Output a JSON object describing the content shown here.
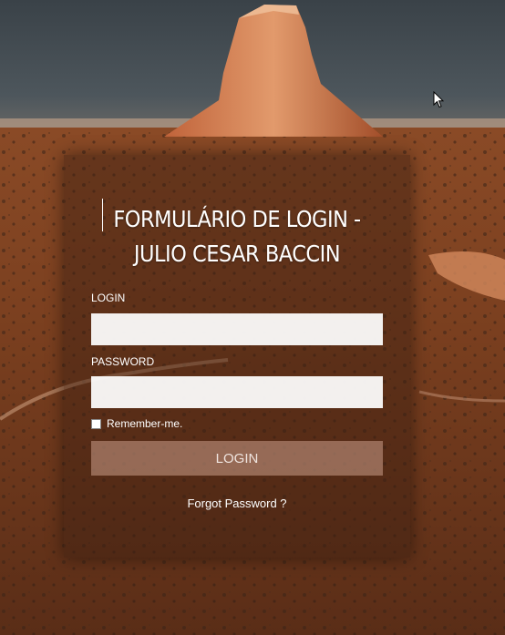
{
  "form": {
    "title_line1": "FORMULÁRIO DE LOGIN -",
    "title_line2": "JULIO CESAR BACCIN",
    "login_label": "LOGIN",
    "login_value": "",
    "password_label": "PASSWORD",
    "password_value": "",
    "remember_label": "Remember-me.",
    "remember_checked": false,
    "submit_label": "LOGIN",
    "forgot_label": "Forgot Password ?"
  },
  "icons": {
    "cursor": "arrow-cursor-icon"
  }
}
